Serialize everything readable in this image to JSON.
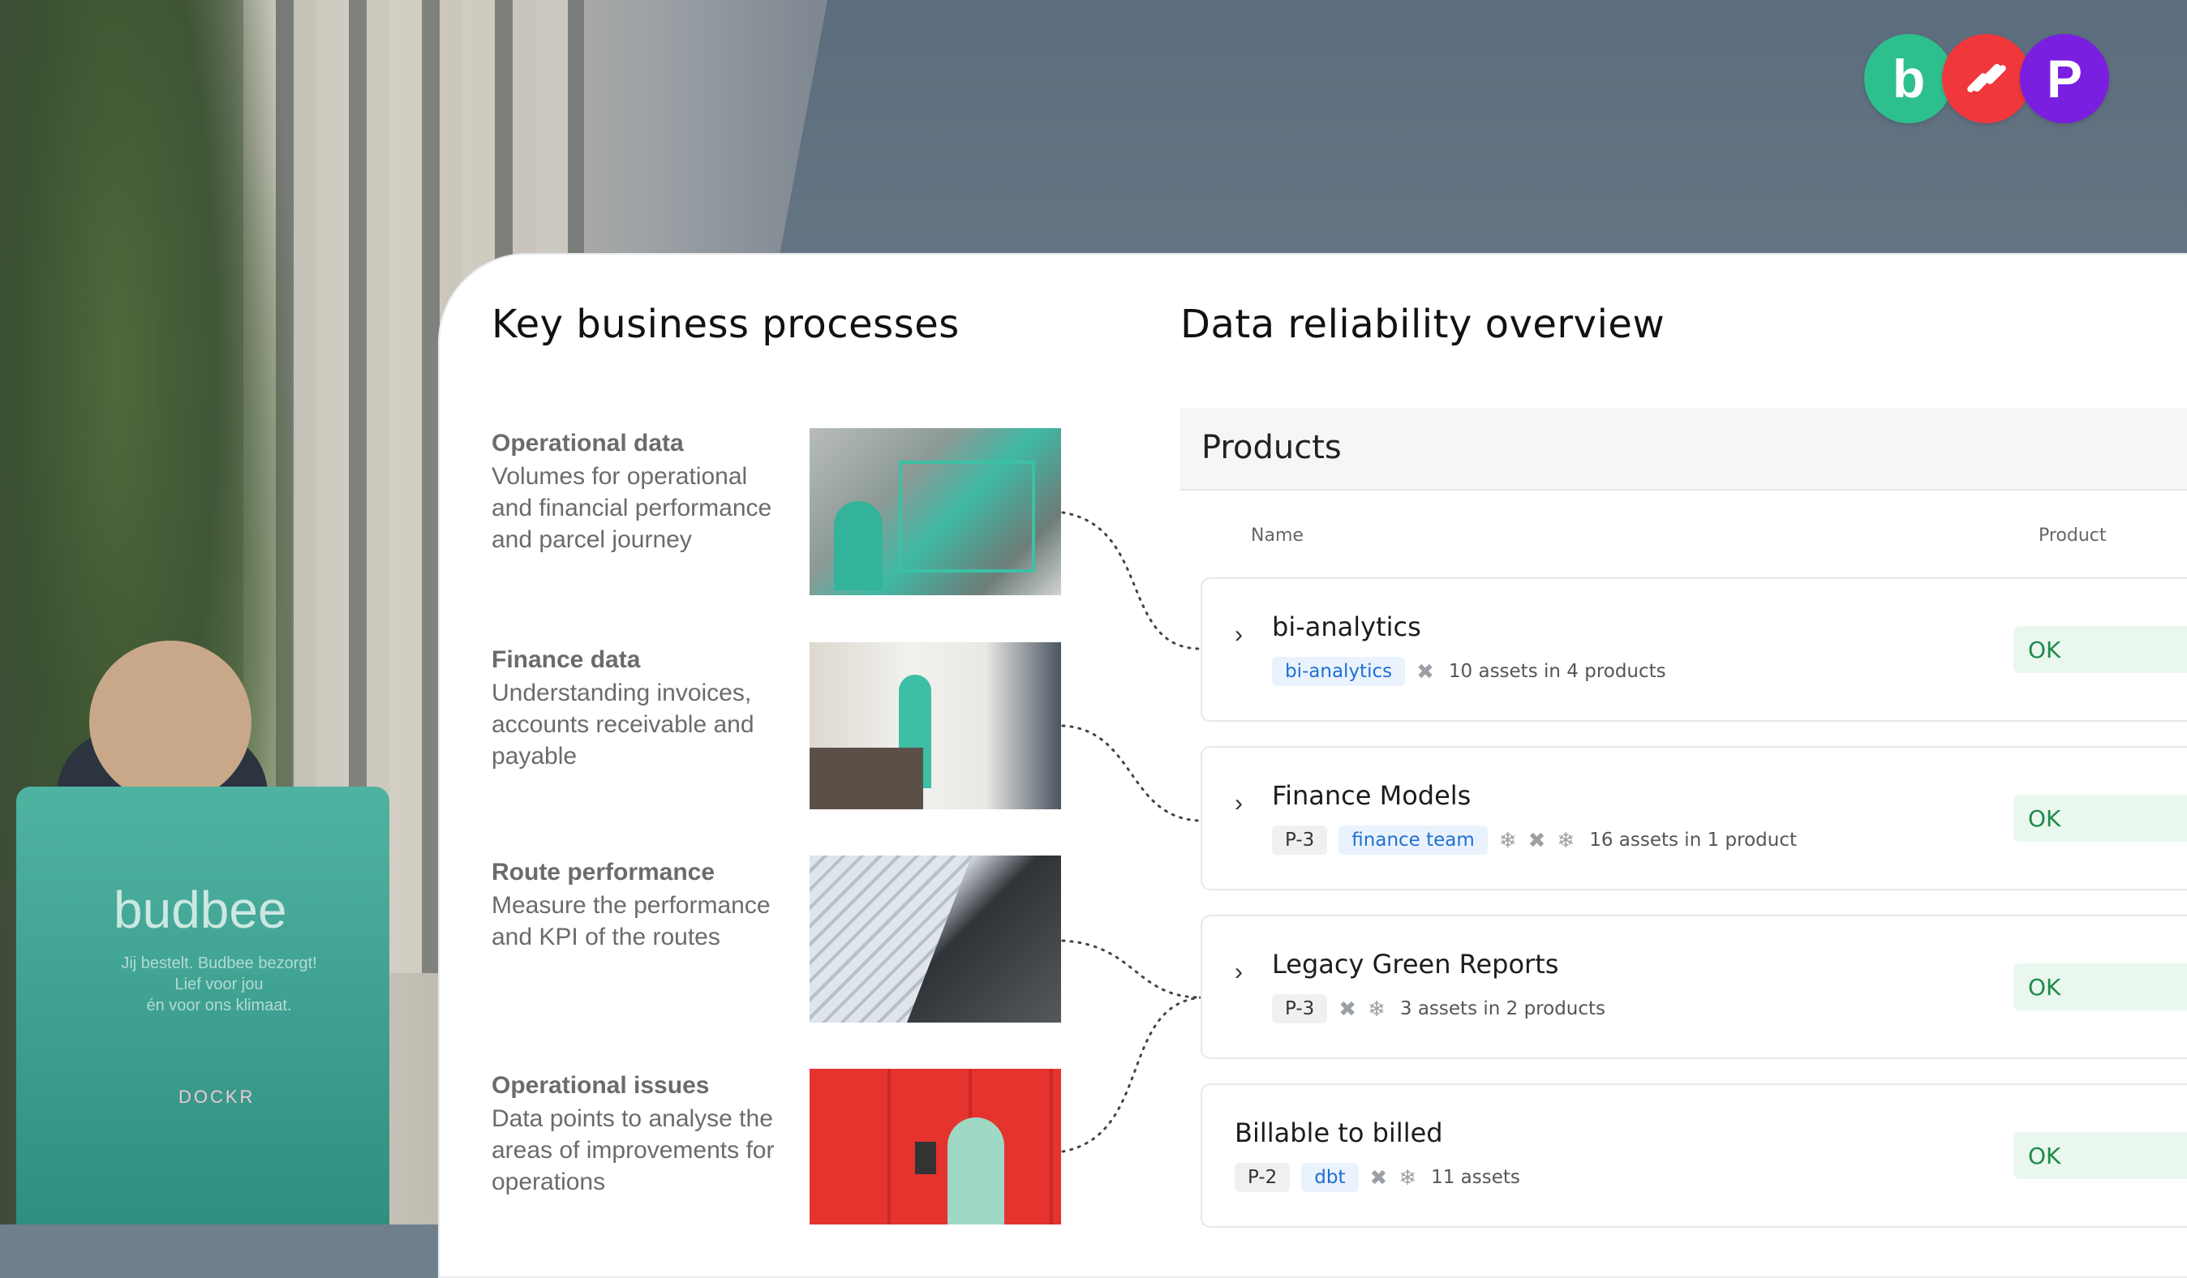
{
  "logos": [
    {
      "letter": "b",
      "color": "#2ebf8f"
    },
    {
      "letter": "",
      "color": "#f0383c"
    },
    {
      "letter": "P",
      "color": "#7a1fe0"
    }
  ],
  "background": {
    "vehicle_text": "budbee",
    "vehicle_sub": "Jij bestelt. Budbee bezorgt!",
    "vehicle_sub2": "Lief voor jou",
    "vehicle_sub3": "én voor ons klimaat.",
    "vehicle_brand": "DOCKR"
  },
  "left": {
    "heading": "Key business processes",
    "processes": [
      {
        "title": "Operational data",
        "desc": "Volumes for operational and financial performance and parcel journey",
        "image": "warehouse-worker-photo"
      },
      {
        "title": "Finance data",
        "desc": "Understanding invoices, accounts receivable and payable",
        "image": "delivery-at-door-photo"
      },
      {
        "title": "Route performance",
        "desc": "Measure the performance and KPI of the routes",
        "image": "rooftop-solar-photo"
      },
      {
        "title": "Operational issues",
        "desc": "Data points to analyse the areas of improvements for operations",
        "image": "parcel-locker-photo"
      }
    ]
  },
  "right": {
    "heading": "Data reliability overview",
    "products_title": "Products",
    "col_name": "Name",
    "col_product": "Product",
    "rows": [
      {
        "name": "bi-analytics",
        "tags": [
          {
            "text": "bi-analytics",
            "style": "blue"
          }
        ],
        "icons": [
          "dbt-icon"
        ],
        "assets": "10 assets in 4 products",
        "status": "OK",
        "expandable": true
      },
      {
        "name": "Finance Models",
        "tags": [
          {
            "text": "P-3",
            "style": "gray"
          },
          {
            "text": "finance team",
            "style": "blue"
          }
        ],
        "icons": [
          "snowflake-icon",
          "dbt-icon",
          "snowflake-icon"
        ],
        "assets": "16 assets in 1 product",
        "status": "OK",
        "expandable": true
      },
      {
        "name": "Legacy Green Reports",
        "tags": [
          {
            "text": "P-3",
            "style": "gray"
          }
        ],
        "icons": [
          "dbt-icon",
          "snowflake-icon"
        ],
        "assets": "3 assets in 2 products",
        "status": "OK",
        "expandable": true
      },
      {
        "name": "Billable to billed",
        "tags": [
          {
            "text": "P-2",
            "style": "gray"
          },
          {
            "text": "dbt",
            "style": "blue"
          }
        ],
        "icons": [
          "dbt-icon",
          "snowflake-icon"
        ],
        "assets": "11 assets",
        "status": "OK",
        "expandable": false
      }
    ]
  }
}
